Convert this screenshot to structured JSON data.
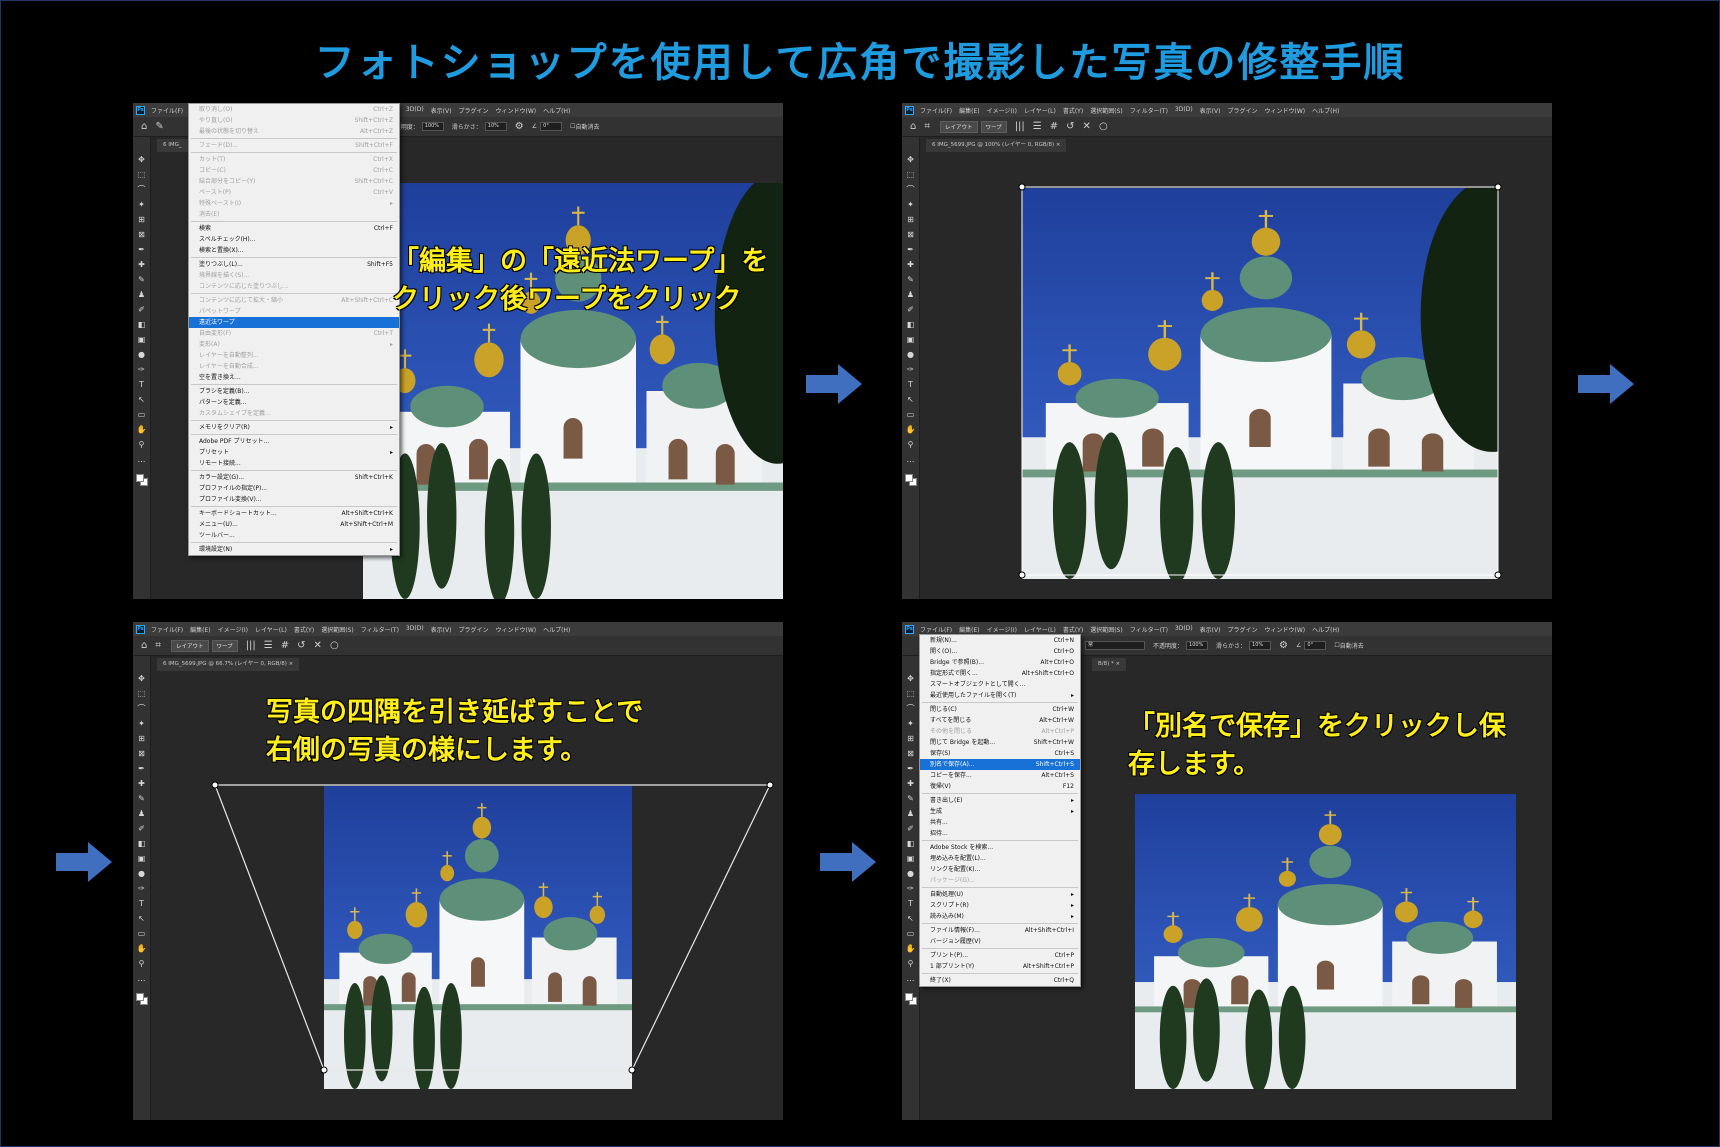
{
  "title": "フォトショップを使用して広角で撮影した写真の修整手順",
  "menu_items": [
    "ファイル(F)",
    "編集(E)",
    "イメージ(I)",
    "レイヤー(L)",
    "書式(Y)",
    "選択範囲(S)",
    "フィルター(T)",
    "3D(D)",
    "表示(V)",
    "プラグイン",
    "ウィンドウ(W)",
    "ヘルプ(H)"
  ],
  "ps_logo": "Ps",
  "icons": {
    "home": "home-icon",
    "move": "move-icon",
    "undo": "undo-icon",
    "cancel": "cancel-icon",
    "commit": "commit-icon"
  },
  "panel1": {
    "options": {
      "opacity_label": "不透明度：",
      "opacity_value": "100%",
      "smooth_label": "滑らかさ：",
      "smooth_value": "10%",
      "angle_value": "0°",
      "auto_erase_label": "自動消去"
    },
    "tab_label": "6 IMG_",
    "edit_menu": [
      {
        "label": "取り消し(O)",
        "shortcut": "Ctrl+Z",
        "disabled": true
      },
      {
        "label": "やり直し(O)",
        "shortcut": "Shift+Ctrl+Z",
        "disabled": true
      },
      {
        "label": "最後の状態を切り替え",
        "shortcut": "Alt+Ctrl+Z",
        "disabled": true
      },
      {
        "sep": true
      },
      {
        "label": "フェード(D)...",
        "shortcut": "Shift+Ctrl+F",
        "disabled": true
      },
      {
        "sep": true
      },
      {
        "label": "カット(T)",
        "shortcut": "Ctrl+X",
        "disabled": true
      },
      {
        "label": "コピー(C)",
        "shortcut": "Ctrl+C",
        "disabled": true
      },
      {
        "label": "結合部分をコピー(Y)",
        "shortcut": "Shift+Ctrl+C",
        "disabled": true
      },
      {
        "label": "ペースト(P)",
        "shortcut": "Ctrl+V",
        "disabled": true
      },
      {
        "label": "特殊ペースト(I)",
        "shortcut": "▸",
        "disabled": true
      },
      {
        "label": "消去(E)",
        "shortcut": "",
        "disabled": true
      },
      {
        "sep": true
      },
      {
        "label": "検索",
        "shortcut": "Ctrl+F"
      },
      {
        "label": "スペルチェック(H)...",
        "shortcut": ""
      },
      {
        "label": "検索と置換(X)...",
        "shortcut": ""
      },
      {
        "sep": true
      },
      {
        "label": "塗りつぶし(L)...",
        "shortcut": "Shift+F5"
      },
      {
        "label": "境界線を描く(S)...",
        "shortcut": "",
        "disabled": true
      },
      {
        "label": "コンテンツに応じた塗りつぶし...",
        "shortcut": "",
        "disabled": true
      },
      {
        "sep": true
      },
      {
        "label": "コンテンツに応じて拡大・縮小",
        "shortcut": "Alt+Shift+Ctrl+C",
        "disabled": true
      },
      {
        "label": "パペットワープ",
        "shortcut": "",
        "disabled": true
      },
      {
        "label": "遠近法ワープ",
        "shortcut": "",
        "highlight": true
      },
      {
        "label": "自由変形(F)",
        "shortcut": "Ctrl+T",
        "disabled": true
      },
      {
        "label": "変形(A)",
        "shortcut": "▸",
        "disabled": true
      },
      {
        "label": "レイヤーを自動整列...",
        "shortcut": "",
        "disabled": true
      },
      {
        "label": "レイヤーを自動合成...",
        "shortcut": "",
        "disabled": true
      },
      {
        "label": "空を置き換え...",
        "shortcut": ""
      },
      {
        "sep": true
      },
      {
        "label": "ブラシを定義(B)...",
        "shortcut": ""
      },
      {
        "label": "パターンを定義...",
        "shortcut": ""
      },
      {
        "label": "カスタムシェイプを定義...",
        "shortcut": "",
        "disabled": true
      },
      {
        "sep": true
      },
      {
        "label": "メモリをクリア(R)",
        "shortcut": "▸"
      },
      {
        "sep": true
      },
      {
        "label": "Adobe PDF プリセット...",
        "shortcut": ""
      },
      {
        "label": "プリセット",
        "shortcut": "▸"
      },
      {
        "label": "リモート接続...",
        "shortcut": ""
      },
      {
        "sep": true
      },
      {
        "label": "カラー設定(G)...",
        "shortcut": "Shift+Ctrl+K"
      },
      {
        "label": "プロファイルの指定(P)...",
        "shortcut": ""
      },
      {
        "label": "プロファイル変換(V)...",
        "shortcut": ""
      },
      {
        "sep": true
      },
      {
        "label": "キーボードショートカット...",
        "shortcut": "Alt+Shift+Ctrl+K"
      },
      {
        "label": "メニュー(U)...",
        "shortcut": "Alt+Shift+Ctrl+M"
      },
      {
        "label": "ツールバー...",
        "shortcut": ""
      },
      {
        "sep": true
      },
      {
        "label": "環境設定(N)",
        "shortcut": "▸"
      }
    ],
    "caption_lines": [
      "「編集」の「遠近法ワープ」を",
      "クリック後ワープをクリック"
    ]
  },
  "panel2": {
    "layout_btn": "レイアウト",
    "warp_btn": "ワープ",
    "tab_label": "6 IMG_5699.JPG @ 100% (レイヤー 0, RGB/8)  ×"
  },
  "panel3": {
    "layout_btn": "レイアウト",
    "warp_btn": "ワープ",
    "tab_label": "6 IMG_5699.JPG @ 66.7% (レイヤー 0, RGB/8)  ×",
    "caption_lines": [
      "写真の四隅を引き延ばすことで",
      "右側の写真の様にします。"
    ]
  },
  "panel4": {
    "options": {
      "opacity_label": "不透明度：",
      "opacity_value": "100%",
      "smooth_label": "滑らかさ：",
      "smooth_value": "10%",
      "angle_value": "0°",
      "auto_erase_label": "自動消去",
      "mode_value": "常"
    },
    "tab_label": "B/8) *  ×",
    "file_menu": [
      {
        "label": "新規(N)...",
        "shortcut": "Ctrl+N"
      },
      {
        "label": "開く(O)...",
        "shortcut": "Ctrl+O"
      },
      {
        "label": "Bridge で参照(B)...",
        "shortcut": "Alt+Ctrl+O"
      },
      {
        "label": "指定形式で開く...",
        "shortcut": "Alt+Shift+Ctrl+O"
      },
      {
        "label": "スマートオブジェクトとして開く...",
        "shortcut": ""
      },
      {
        "label": "最近使用したファイルを開く(T)",
        "shortcut": "▸"
      },
      {
        "sep": true
      },
      {
        "label": "閉じる(C)",
        "shortcut": "Ctrl+W"
      },
      {
        "label": "すべてを閉じる",
        "shortcut": "Alt+Ctrl+W"
      },
      {
        "label": "その他を閉じる",
        "shortcut": "Alt+Ctrl+P",
        "disabled": true
      },
      {
        "label": "閉じて Bridge を起動...",
        "shortcut": "Shift+Ctrl+W"
      },
      {
        "label": "保存(S)",
        "shortcut": "Ctrl+S"
      },
      {
        "label": "別名で保存(A)...",
        "shortcut": "Shift+Ctrl+S",
        "highlight": true
      },
      {
        "label": "コピーを保存...",
        "shortcut": "Alt+Ctrl+S"
      },
      {
        "label": "復帰(V)",
        "shortcut": "F12"
      },
      {
        "sep": true
      },
      {
        "label": "書き出し(E)",
        "shortcut": "▸"
      },
      {
        "label": "生成",
        "shortcut": "▸"
      },
      {
        "label": "共有...",
        "shortcut": ""
      },
      {
        "label": "招待...",
        "shortcut": ""
      },
      {
        "sep": true
      },
      {
        "label": "Adobe Stock を検索...",
        "shortcut": ""
      },
      {
        "label": "埋め込みを配置(L)...",
        "shortcut": ""
      },
      {
        "label": "リンクを配置(K)...",
        "shortcut": ""
      },
      {
        "label": "パッケージ(G)...",
        "shortcut": "",
        "disabled": true
      },
      {
        "sep": true
      },
      {
        "label": "自動処理(U)",
        "shortcut": "▸"
      },
      {
        "label": "スクリプト(R)",
        "shortcut": "▸"
      },
      {
        "label": "読み込み(M)",
        "shortcut": "▸"
      },
      {
        "sep": true
      },
      {
        "label": "ファイル情報(F)...",
        "shortcut": "Alt+Shift+Ctrl+I"
      },
      {
        "label": "バージョン履歴(V)",
        "shortcut": ""
      },
      {
        "sep": true
      },
      {
        "label": "プリント(P)...",
        "shortcut": "Ctrl+P"
      },
      {
        "label": "1 部プリント(Y)",
        "shortcut": "Alt+Shift+Ctrl+P"
      },
      {
        "sep": true
      },
      {
        "label": "終了(X)",
        "shortcut": "Ctrl+Q"
      }
    ],
    "caption_lines": [
      "「別名で保存」をクリックし保",
      "存します。"
    ]
  },
  "colors": {
    "title": "#1f9be0",
    "caption": "#ffee1a",
    "arrow": "#3f6fbe",
    "menu_highlight": "#1871d6"
  }
}
